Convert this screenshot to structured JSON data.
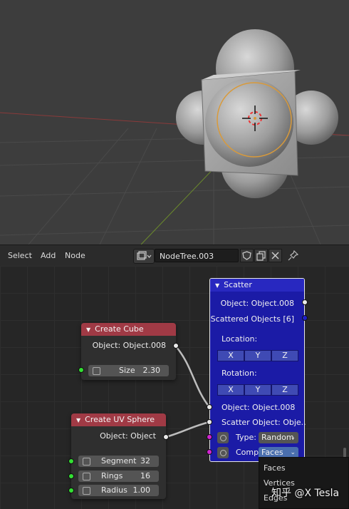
{
  "header": {
    "menus": [
      "Select",
      "Add",
      "Node"
    ],
    "tree_name": "NodeTree.003"
  },
  "nodes": {
    "create_cube": {
      "title": "Create Cube",
      "output": "Object: Object.008",
      "size_label": "Size",
      "size_value": "2.30"
    },
    "create_uv_sphere": {
      "title": "Create UV Sphere",
      "output": "Object: Object",
      "segment_label": "Segment",
      "segment_value": "32",
      "rings_label": "Rings",
      "rings_value": "16",
      "radius_label": "Radius",
      "radius_value": "1.00"
    },
    "scatter": {
      "title": "Scatter",
      "out_object": "Object: Object.008",
      "out_scattered": "Scattered Objects [6]",
      "location_label": "Location:",
      "rotation_label": "Rotation:",
      "axes": [
        "X",
        "Y",
        "Z"
      ],
      "in_object": "Object: Object.008",
      "in_scatter_object": "Scatter Object: Obje..",
      "type_label": "Type:",
      "type_value": "Random",
      "comp_label": "Comp",
      "comp_value": "Faces"
    }
  },
  "dropdown_menu": {
    "items": [
      "Faces",
      "Vertices",
      "Edges"
    ]
  },
  "watermark": "知乎 @X Tesla",
  "colors": {
    "node_header_red": "#a03a45",
    "scatter_blue": "#1b1ba6",
    "socket_green": "#33e033",
    "socket_magenta": "#d024d0"
  }
}
